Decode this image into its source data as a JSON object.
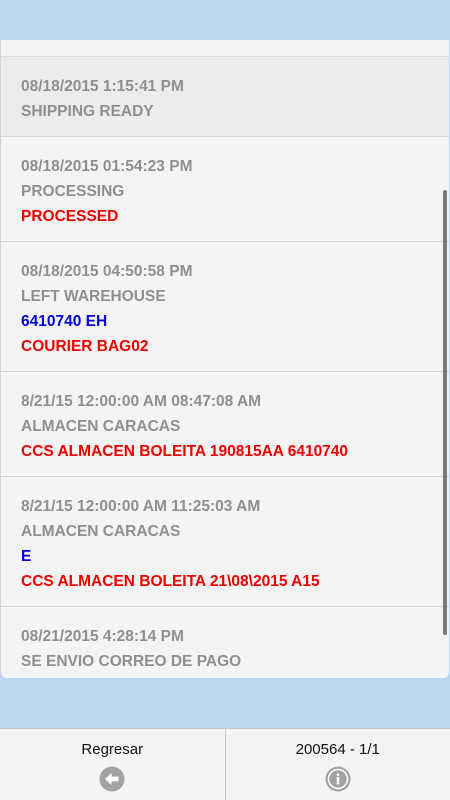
{
  "events": [
    {
      "highlight": true,
      "lines": [
        {
          "text": "08/18/2015 1:15:41 PM",
          "color": "gray"
        },
        {
          "text": "SHIPPING READY",
          "color": "gray"
        }
      ]
    },
    {
      "highlight": false,
      "lines": [
        {
          "text": "08/18/2015 01:54:23 PM",
          "color": "gray"
        },
        {
          "text": "PROCESSING",
          "color": "gray"
        },
        {
          "text": "PROCESSED",
          "color": "red"
        }
      ]
    },
    {
      "highlight": false,
      "lines": [
        {
          "text": "08/18/2015 04:50:58 PM",
          "color": "gray"
        },
        {
          "text": "LEFT WAREHOUSE",
          "color": "gray"
        },
        {
          "text": "6410740 EH",
          "color": "blue"
        },
        {
          "text": "COURIER BAG02",
          "color": "red"
        }
      ]
    },
    {
      "highlight": false,
      "lines": [
        {
          "text": "8/21/15 12:00:00 AM 08:47:08 AM",
          "color": "gray"
        },
        {
          "text": "ALMACEN CARACAS",
          "color": "gray"
        },
        {
          "text": "CCS ALMACEN BOLEITA 190815AA 6410740",
          "color": "red"
        }
      ]
    },
    {
      "highlight": false,
      "lines": [
        {
          "text": "8/21/15 12:00:00 AM 11:25:03 AM",
          "color": "gray"
        },
        {
          "text": "ALMACEN CARACAS",
          "color": "gray"
        },
        {
          "text": "E",
          "color": "blue"
        },
        {
          "text": "CCS ALMACEN BOLEITA 21\\08\\2015 A15",
          "color": "red"
        }
      ]
    },
    {
      "highlight": false,
      "lines": [
        {
          "text": "08/21/2015 4:28:14 PM",
          "color": "gray"
        },
        {
          "text": "SE ENVIO CORREO DE PAGO",
          "color": "gray"
        }
      ]
    }
  ],
  "colors": {
    "gray": "#8f8f8f",
    "red": "#ee0000",
    "blue": "#0000dd",
    "background": "#bcd6ef"
  },
  "footer": {
    "back_label": "Regresar",
    "back_icon": "arrow-left-circle-icon",
    "info_label": "200564 - 1/1",
    "info_icon": "info-circle-icon"
  }
}
